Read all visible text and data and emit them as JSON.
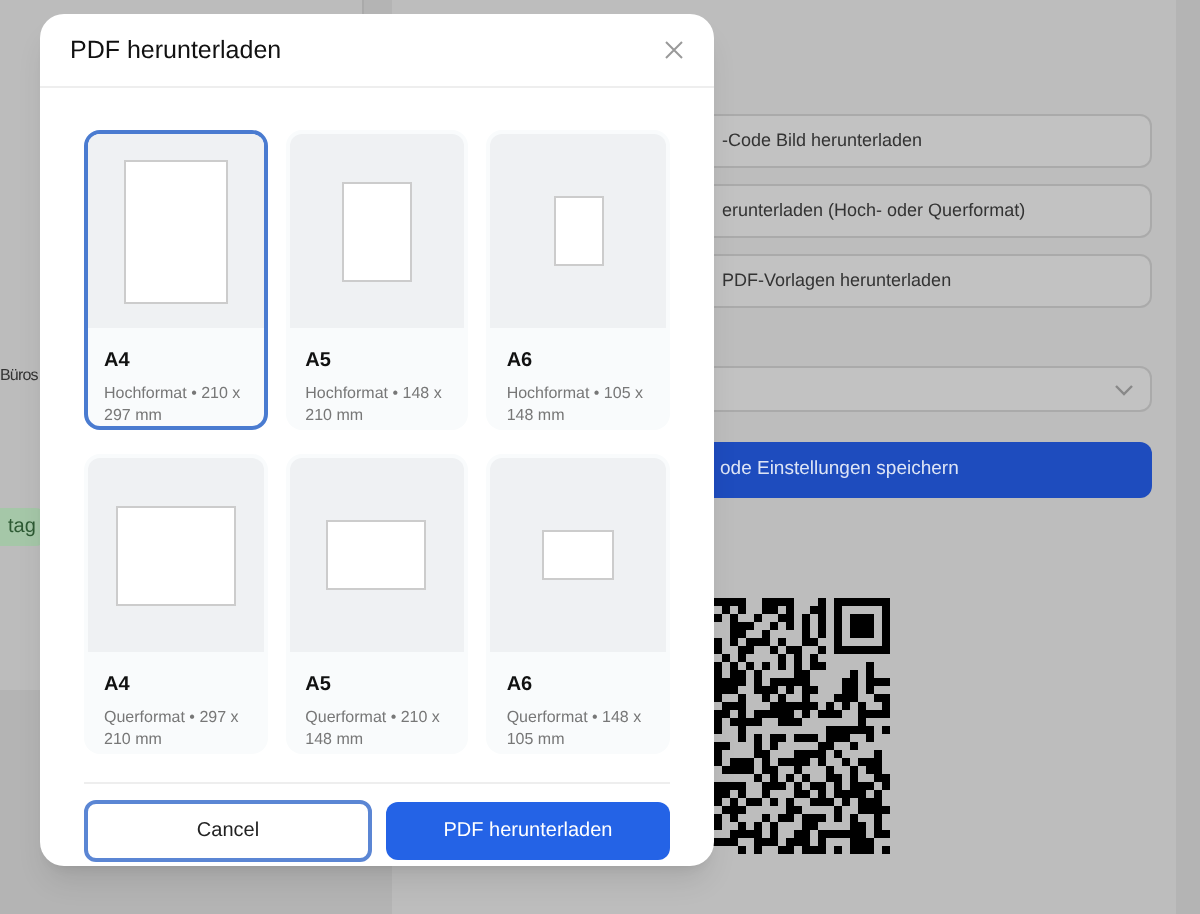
{
  "background": {
    "left_texts": [
      "Büros"
    ],
    "left_badge": "tag",
    "actions": [
      "-Code Bild herunterladen",
      "erunterladen (Hoch- oder Querformat)",
      "PDF-Vorlagen herunterladen"
    ],
    "save_button": "ode Einstellungen speichern"
  },
  "dialog": {
    "title": "PDF herunterladen",
    "formats": [
      {
        "name": "A4",
        "description": "Hochformat • 210 x 297 mm",
        "kind": "portrait",
        "selected": true
      },
      {
        "name": "A5",
        "description": "Hochformat • 148 x 210 mm",
        "kind": "portrait",
        "selected": false
      },
      {
        "name": "A6",
        "description": "Hochformat • 105 x 148 mm",
        "kind": "portrait",
        "selected": false
      },
      {
        "name": "A4",
        "description": "Querformat • 297 x 210 mm",
        "kind": "landscape",
        "selected": false
      },
      {
        "name": "A5",
        "description": "Querformat • 210 x 148 mm",
        "kind": "landscape",
        "selected": false
      },
      {
        "name": "A6",
        "description": "Querformat • 148 x 105 mm",
        "kind": "landscape",
        "selected": false
      }
    ],
    "cancel": "Cancel",
    "confirm": "PDF herunterladen"
  }
}
